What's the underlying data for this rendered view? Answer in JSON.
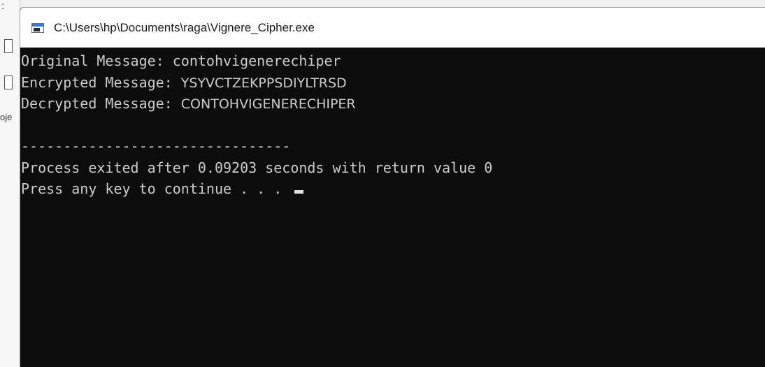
{
  "window": {
    "title": "C:\\Users\\hp\\Documents\\raga\\Vignere_Cipher.exe"
  },
  "background_app": {
    "glyph_top": ":",
    "partial_text": "oje"
  },
  "console": {
    "lines": {
      "original_label": "Original Message: ",
      "original_value": "contohvigenerechiper",
      "encrypted_label": "Encrypted Message: ",
      "encrypted_value": "YSYVCTZEKPPSDIYLTRSD",
      "decrypted_label": "Decrypted Message: ",
      "decrypted_value": "CONTOHVIGENERECHIPER",
      "separator": "--------------------------------",
      "process_exit": "Process exited after 0.09203 seconds with return value 0",
      "press_key": "Press any key to continue . . . "
    }
  },
  "colors": {
    "console_bg": "#0c0c0c",
    "console_text": "#cccccc",
    "title_bar_bg": "#ffffff"
  }
}
